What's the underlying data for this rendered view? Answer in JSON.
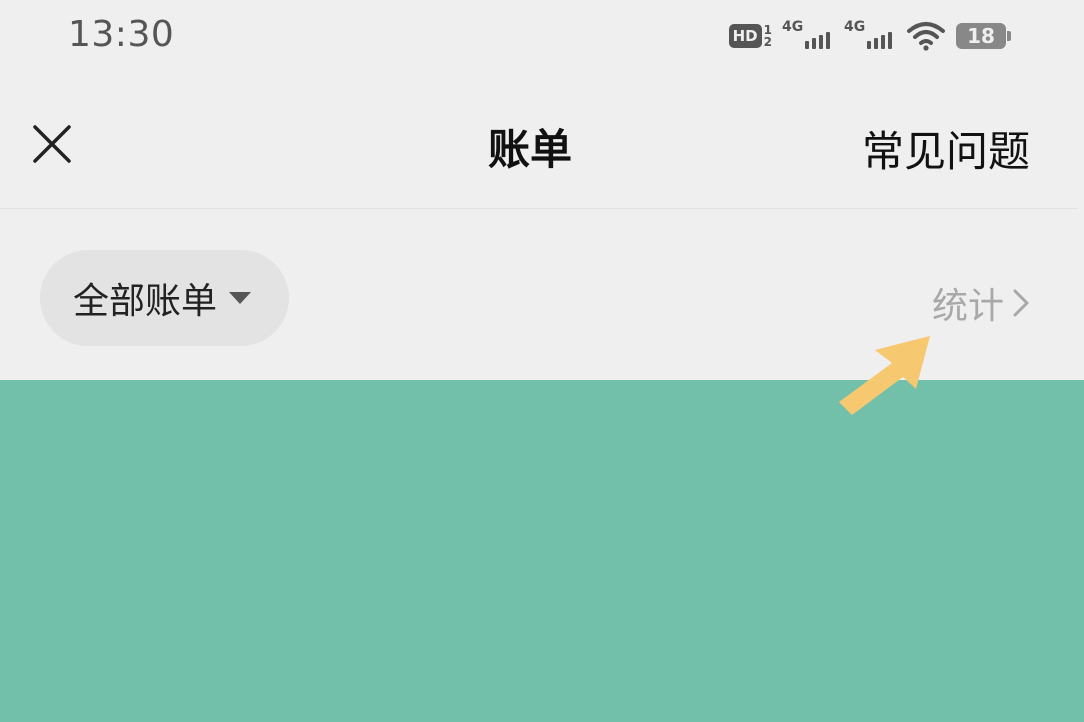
{
  "status_bar": {
    "time": "13:30",
    "hd_label": "HD",
    "hd_sim_top": "1",
    "hd_sim_bottom": "2",
    "signal_1_label": "4G",
    "signal_2_label": "4G",
    "battery_level": "18"
  },
  "nav_bar": {
    "title": "账单",
    "faq_label": "常见问题"
  },
  "filter": {
    "selected_label": "全部账单",
    "stats_label": "统计"
  },
  "colors": {
    "background": "#efefef",
    "content_teal": "#73c0aa",
    "arrow_yellow": "#f6c86f",
    "stats_gray": "#a8a8a8",
    "pill_gray": "#e3e3e3"
  },
  "icons": {
    "close": "close-icon",
    "dropdown": "caret-down-icon",
    "chevron": "chevron-right-icon",
    "wifi": "wifi-icon",
    "battery": "battery-icon",
    "arrow": "arrow-annotation-icon"
  }
}
